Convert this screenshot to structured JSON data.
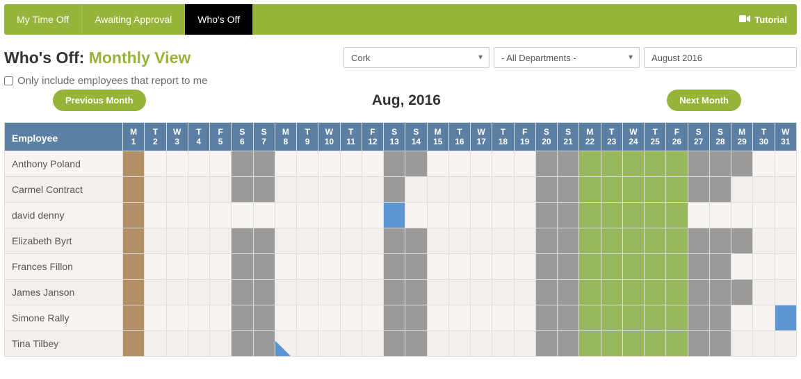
{
  "tabs": [
    {
      "label": "My Time Off",
      "active": false
    },
    {
      "label": "Awaiting Approval",
      "active": false
    },
    {
      "label": "Who's Off",
      "active": true
    }
  ],
  "tutorial_label": "Tutorial",
  "heading_black": "Who's Off: ",
  "heading_green": "Monthly View",
  "filter_location": {
    "selected": "Cork",
    "options": [
      "Cork"
    ]
  },
  "filter_department": {
    "selected": "- All Departments -",
    "options": [
      "- All Departments -"
    ]
  },
  "filter_month_value": "August 2016",
  "checkbox_label": "Only include employees that report to me",
  "checkbox_checked": false,
  "prev_button": "Previous Month",
  "next_button": "Next Month",
  "month_title": "Aug, 2016",
  "employee_header": "Employee",
  "days": [
    {
      "dow": "M",
      "num": "1"
    },
    {
      "dow": "T",
      "num": "2"
    },
    {
      "dow": "W",
      "num": "3"
    },
    {
      "dow": "T",
      "num": "4"
    },
    {
      "dow": "F",
      "num": "5"
    },
    {
      "dow": "S",
      "num": "6"
    },
    {
      "dow": "S",
      "num": "7"
    },
    {
      "dow": "M",
      "num": "8"
    },
    {
      "dow": "T",
      "num": "9"
    },
    {
      "dow": "W",
      "num": "10"
    },
    {
      "dow": "T",
      "num": "11"
    },
    {
      "dow": "F",
      "num": "12"
    },
    {
      "dow": "S",
      "num": "13"
    },
    {
      "dow": "S",
      "num": "14"
    },
    {
      "dow": "M",
      "num": "15"
    },
    {
      "dow": "T",
      "num": "16"
    },
    {
      "dow": "W",
      "num": "17"
    },
    {
      "dow": "T",
      "num": "18"
    },
    {
      "dow": "F",
      "num": "19"
    },
    {
      "dow": "S",
      "num": "20"
    },
    {
      "dow": "S",
      "num": "21"
    },
    {
      "dow": "M",
      "num": "22"
    },
    {
      "dow": "T",
      "num": "23"
    },
    {
      "dow": "W",
      "num": "24"
    },
    {
      "dow": "T",
      "num": "25"
    },
    {
      "dow": "F",
      "num": "26"
    },
    {
      "dow": "S",
      "num": "27"
    },
    {
      "dow": "S",
      "num": "28"
    },
    {
      "dow": "M",
      "num": "29"
    },
    {
      "dow": "T",
      "num": "30"
    },
    {
      "dow": "W",
      "num": "31"
    }
  ],
  "legend_colors": {
    "brown": "#b48f65",
    "grey": "#9a9a9a",
    "green": "#97b85b",
    "blue": "#5f95d2"
  },
  "rows": [
    {
      "name": "Anthony Poland",
      "cells": [
        "brown",
        "",
        "",
        "",
        "",
        "grey",
        "grey",
        "",
        "",
        "",
        "",
        "",
        "grey",
        "grey",
        "",
        "",
        "",
        "",
        "",
        "grey",
        "grey",
        "green",
        "green",
        "green",
        "green",
        "green",
        "grey",
        "grey",
        "grey",
        "",
        ""
      ]
    },
    {
      "name": "Carmel Contract",
      "cells": [
        "brown",
        "",
        "",
        "",
        "",
        "grey",
        "grey",
        "",
        "",
        "",
        "",
        "",
        "grey",
        "",
        "",
        "",
        "",
        "",
        "",
        "grey",
        "grey",
        "green",
        "green",
        "green",
        "green",
        "green",
        "grey",
        "grey",
        "",
        "",
        ""
      ]
    },
    {
      "name": "david denny",
      "cells": [
        "brown",
        "",
        "",
        "",
        "",
        "",
        "",
        "",
        "",
        "",
        "",
        "",
        "blue",
        "",
        "",
        "",
        "",
        "",
        "",
        "grey",
        "grey",
        "green",
        "green",
        "green",
        "green",
        "green",
        "",
        "",
        "",
        "",
        ""
      ]
    },
    {
      "name": "Elizabeth Byrt",
      "cells": [
        "brown",
        "",
        "",
        "",
        "",
        "grey",
        "grey",
        "",
        "",
        "",
        "",
        "",
        "grey",
        "grey",
        "",
        "",
        "",
        "",
        "",
        "grey",
        "grey",
        "green",
        "green",
        "green",
        "green",
        "green",
        "grey",
        "grey",
        "grey",
        "",
        ""
      ]
    },
    {
      "name": "Frances Fillon",
      "cells": [
        "brown",
        "",
        "",
        "",
        "",
        "grey",
        "grey",
        "",
        "",
        "",
        "",
        "",
        "grey",
        "grey",
        "",
        "",
        "",
        "",
        "",
        "grey",
        "grey",
        "green",
        "green",
        "green",
        "green",
        "green",
        "grey",
        "grey",
        "",
        "",
        ""
      ]
    },
    {
      "name": "James Janson",
      "cells": [
        "brown",
        "",
        "",
        "",
        "",
        "grey",
        "grey",
        "",
        "",
        "",
        "",
        "",
        "grey",
        "grey",
        "",
        "",
        "",
        "",
        "",
        "grey",
        "grey",
        "green",
        "green",
        "green",
        "green",
        "green",
        "grey",
        "grey",
        "grey",
        "",
        ""
      ]
    },
    {
      "name": "Simone Rally",
      "cells": [
        "brown",
        "",
        "",
        "",
        "",
        "grey",
        "grey",
        "",
        "",
        "",
        "",
        "",
        "grey",
        "grey",
        "",
        "",
        "",
        "",
        "",
        "grey",
        "grey",
        "green",
        "green",
        "green",
        "green",
        "green",
        "grey",
        "grey",
        "",
        "",
        "blue"
      ]
    },
    {
      "name": "Tina Tilbey",
      "cells": [
        "brown",
        "",
        "",
        "",
        "",
        "grey",
        "grey",
        "tri",
        "",
        "",
        "",
        "",
        "grey",
        "grey",
        "",
        "",
        "",
        "",
        "",
        "grey",
        "grey",
        "green",
        "green",
        "green",
        "green",
        "green",
        "grey",
        "grey",
        "",
        "",
        ""
      ]
    }
  ]
}
